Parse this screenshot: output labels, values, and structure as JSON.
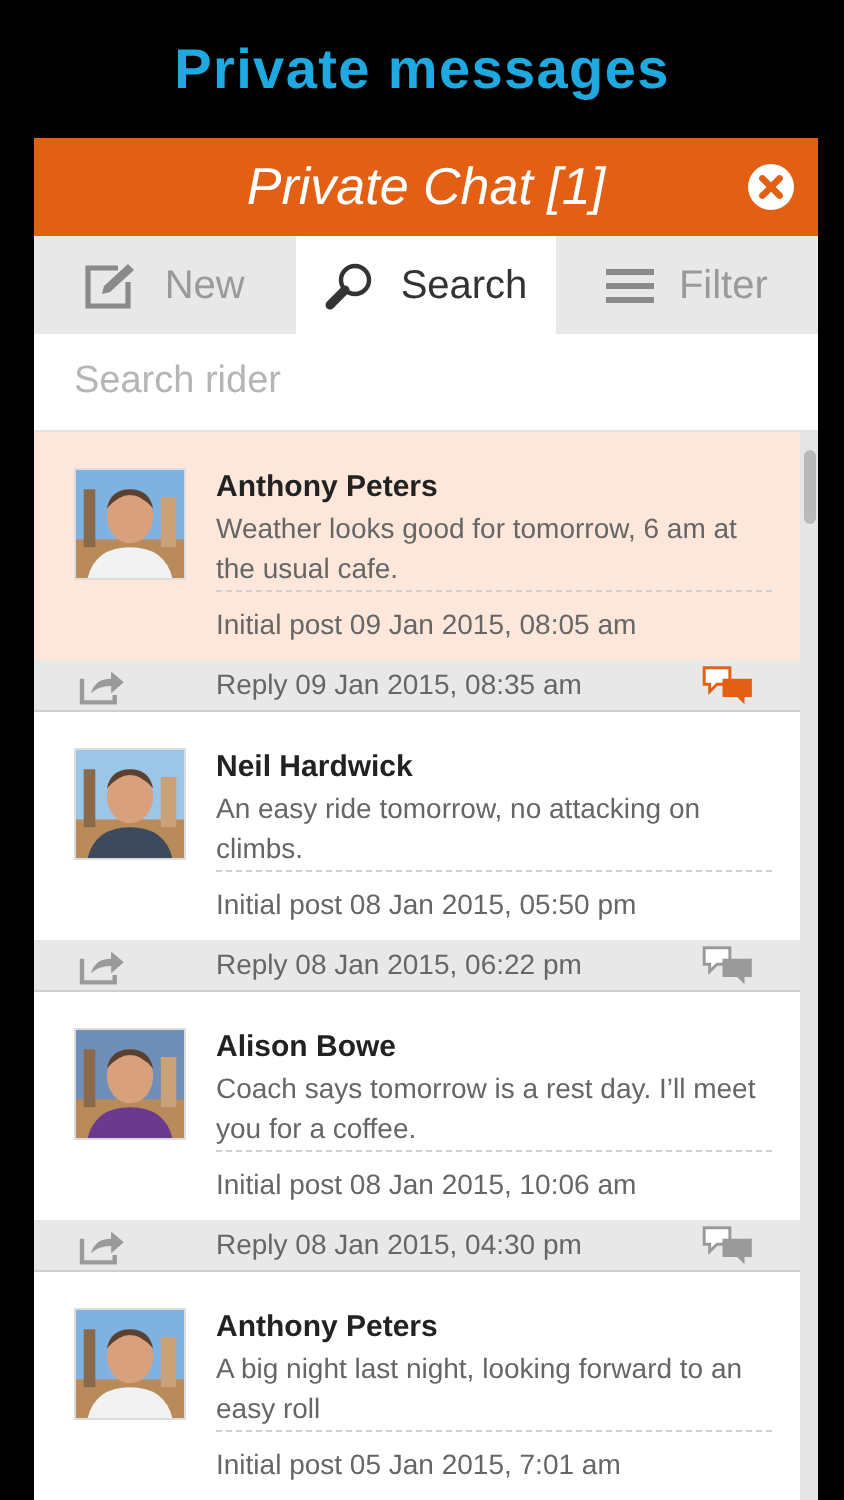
{
  "page_title": "Private messages",
  "header": {
    "title": "Private Chat [1]"
  },
  "tabs": [
    {
      "label": "New",
      "kind": "new",
      "selected": false
    },
    {
      "label": "Search",
      "kind": "search",
      "selected": true
    },
    {
      "label": "Filter",
      "kind": "filter",
      "selected": false
    }
  ],
  "search": {
    "placeholder": "Search rider"
  },
  "messages": [
    {
      "sender": "Anthony Peters",
      "text": "Weather looks good for tomorrow, 6 am at the usual cafe.",
      "initial_post": "Initial post 09 Jan 2015, 08:05 am",
      "reply": "Reply 09 Jan 2015, 08:35 am",
      "unread": true
    },
    {
      "sender": "Neil Hardwick",
      "text": "An easy ride tomorrow, no attacking on climbs.",
      "initial_post": "Initial post 08 Jan 2015, 05:50 pm",
      "reply": "Reply 08 Jan 2015, 06:22 pm",
      "unread": false
    },
    {
      "sender": "Alison Bowe",
      "text": "Coach says tomorrow is a rest day. I’ll meet you for a coffee.",
      "initial_post": "Initial post 08 Jan 2015, 10:06 am",
      "reply": "Reply 08 Jan 2015, 04:30 pm",
      "unread": false
    },
    {
      "sender": "Anthony Peters",
      "text": "A big night last night, looking forward to an easy roll",
      "initial_post": "Initial post 05 Jan 2015, 7:01 am",
      "unread": false
    }
  ]
}
